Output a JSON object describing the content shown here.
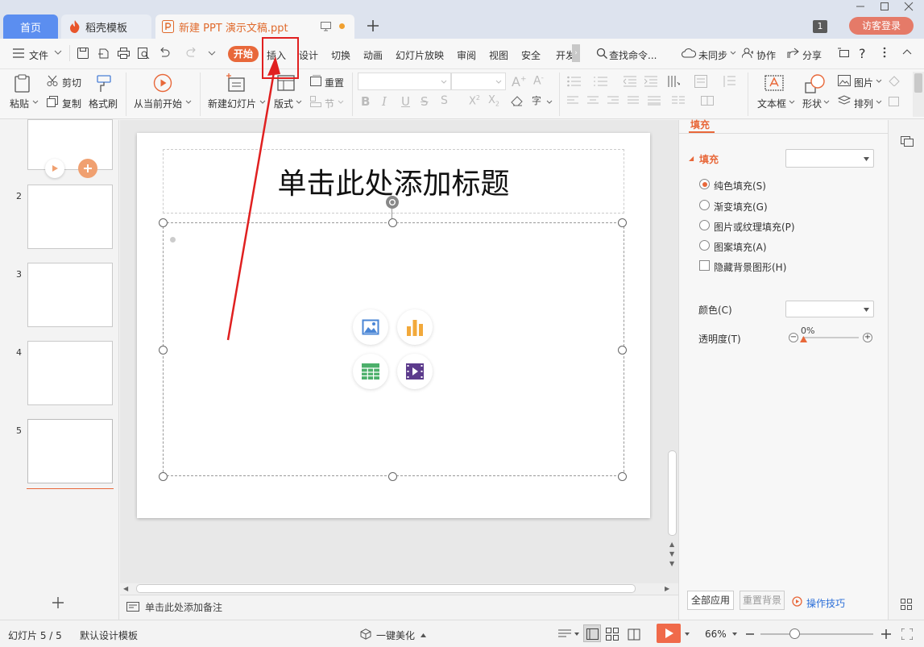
{
  "tabs": {
    "home": "首页",
    "template": "稻壳模板",
    "doc": "新建 PPT 演示文稿.ppt"
  },
  "menu": {
    "file": "文件",
    "start": "开始",
    "insert": "插入",
    "design": "设计",
    "transition": "切换",
    "animation": "动画",
    "slideshow": "幻灯片放映",
    "review": "审阅",
    "view": "视图",
    "security": "安全",
    "dev": "开发",
    "search": "查找命令...",
    "sync": "未同步",
    "collab": "协作",
    "share": "分享"
  },
  "window": {
    "badge": "1",
    "login": "访客登录"
  },
  "ribbon": {
    "paste": "粘贴",
    "cut": "剪切",
    "copy": "复制",
    "format_painter": "格式刷",
    "from_start": "从当前开始",
    "new_slide": "新建幻灯片",
    "layout": "版式",
    "reset": "重置",
    "section": "节",
    "textbox": "文本框",
    "shape": "形状",
    "arrange": "排列",
    "picture": "图片"
  },
  "slides": {
    "numbers": [
      "2",
      "3",
      "4",
      "5"
    ]
  },
  "slide": {
    "title": "单击此处添加标题"
  },
  "notes": "单击此处添加备注",
  "panel": {
    "tab": "填充",
    "section": "填充",
    "solid": "纯色填充(S)",
    "gradient": "渐变填充(G)",
    "picture": "图片或纹理填充(P)",
    "pattern": "图案填充(A)",
    "hide_bg": "隐藏背景图形(H)",
    "color": "颜色(C)",
    "transparency": "透明度(T)",
    "transparency_value": "0%",
    "apply_all": "全部应用",
    "reset_bg": "重置背景",
    "tips": "操作技巧"
  },
  "status": {
    "slide_info": "幻灯片 5 / 5",
    "template": "默认设计模板",
    "beautify": "一键美化",
    "zoom": "66%"
  },
  "colors": {
    "accent": "#e8683a",
    "highlight": "#e02020",
    "home_tab": "#5b8ef0"
  }
}
